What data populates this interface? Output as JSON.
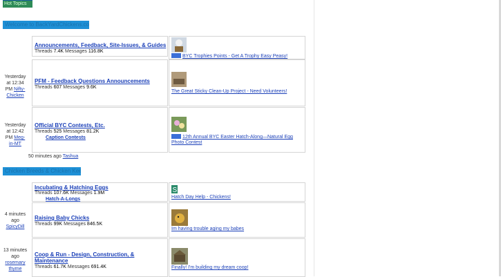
{
  "top_button": {
    "label": "Hot Topics"
  },
  "sections": [
    {
      "title": "Welcome to BackYardChickens.com",
      "forums": [
        {
          "title": "Announcements, Feedback, Site-Issues, & Guides",
          "threads_label": "Threads",
          "threads": "7.4K",
          "messages_label": "Messages",
          "messages": "116.8K",
          "last_post": "BYC Trophies Points - Get A Trophy Easy Peasy!",
          "last_time": "",
          "last_user": ""
        },
        {
          "title": "PFM - Feedback Questions Announcements",
          "threads_label": "Threads",
          "threads": "607",
          "messages_label": "Messages",
          "messages": "9.6K",
          "last_post": "The Great Sticky Clean-Up Project - Need Volunteers!",
          "last_time": "Yesterday at 12:34 PM",
          "last_user": "Nifty-Chicken"
        },
        {
          "title": "Official BYC Contests, Etc.",
          "threads_label": "Threads",
          "threads": "525",
          "messages_label": "Messages",
          "messages": "81.2K",
          "subforum": "Caption Contests",
          "last_post": "12th Annual BYC Easter Hatch-Along—Natural Egg Photo Contest",
          "last_time": "Yesterday at 12:42 PM",
          "last_user": "Meg-in-MT"
        }
      ]
    },
    {
      "title": "Chicken Breeds & Chicken Keeping",
      "forums": [
        {
          "title": "Incubating & Hatching Eggs",
          "threads_label": "Threads",
          "threads": "107.6K",
          "messages_label": "Messages",
          "messages": "1.9M",
          "subforum": "Hatch-A-Longs",
          "last_post": "Hatch Day Help - Chickens!",
          "last_time": "",
          "last_user": ""
        },
        {
          "title": "Raising Baby Chicks",
          "threads_label": "Threads",
          "threads": "99K",
          "messages_label": "Messages",
          "messages": "846.5K",
          "last_post": "Im having trouble aging my babes",
          "last_time": "4 minutes ago",
          "last_user": "SpicyDill"
        },
        {
          "title": "Coop & Run - Design, Construction, & Maintenance",
          "threads_label": "Threads",
          "threads": "61.7K",
          "messages_label": "Messages",
          "messages": "691.4K",
          "last_post": "Finally! I'm building my dream coop!",
          "last_time": "13 minutes ago",
          "last_user": "rosemary thyme"
        }
      ]
    }
  ],
  "between_row": {
    "time": "50 minutes ago",
    "user": "Tashua"
  },
  "colors": {
    "link": "#1a3fb8",
    "header_bg": "#1e90d6",
    "button_bg": "#2e8b57"
  },
  "icons": [
    "trophy-avatar",
    "sticky-thumb",
    "easter-egg-thumb",
    "s-avatar",
    "chick-thumb",
    "coop-thumb"
  ]
}
